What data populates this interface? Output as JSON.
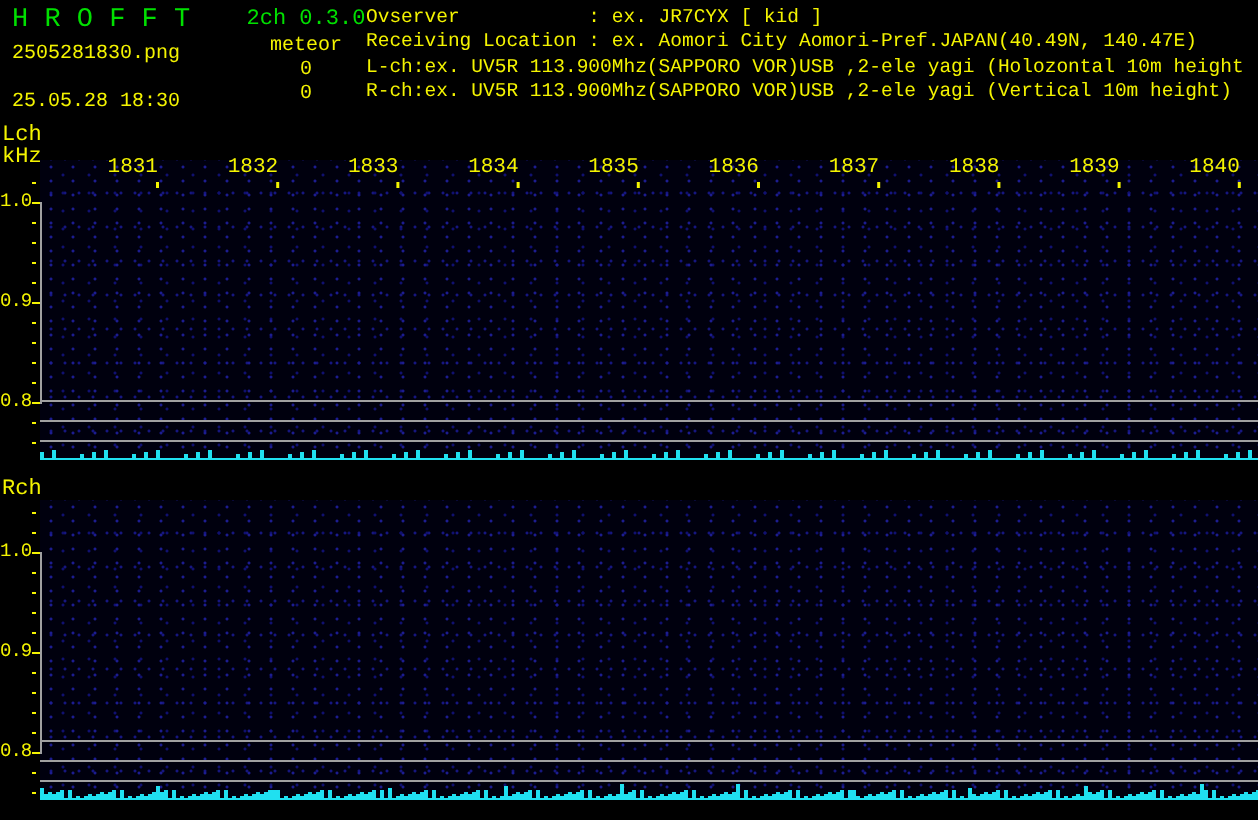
{
  "app": {
    "title": "H R O F F T",
    "version": "2ch 0.3.0",
    "mode": "meteor",
    "filename": "2505281830.png",
    "datetime": "25.05.28 18:30",
    "counts": [
      "0",
      "0"
    ]
  },
  "info_lines": [
    "Ovserver           : ex. JR7CYX [ kid ]",
    "Receiving Location : ex. Aomori City Aomori-Pref.JAPAN(40.49N, 140.47E)",
    "L-ch:ex. UV5R 113.900Mhz(SAPPORO VOR)USB ,2-ele yagi (Holozontal 10m height",
    "R-ch:ex. UV5R 113.900Mhz(SAPPORO VOR)USB ,2-ele yagi (Vertical 10m height)"
  ],
  "channels": [
    {
      "label": "Lch",
      "unit": "kHz",
      "time_ticks": [
        "1831",
        "1832",
        "1833",
        "1834",
        "1835",
        "1836",
        "1837",
        "1838",
        "1839",
        "1840"
      ],
      "freq_ticks": [
        "1.0",
        "0.9",
        "0.8"
      ]
    },
    {
      "label": "Rch",
      "freq_ticks": [
        "1.0",
        "0.9",
        "0.8"
      ]
    }
  ]
}
